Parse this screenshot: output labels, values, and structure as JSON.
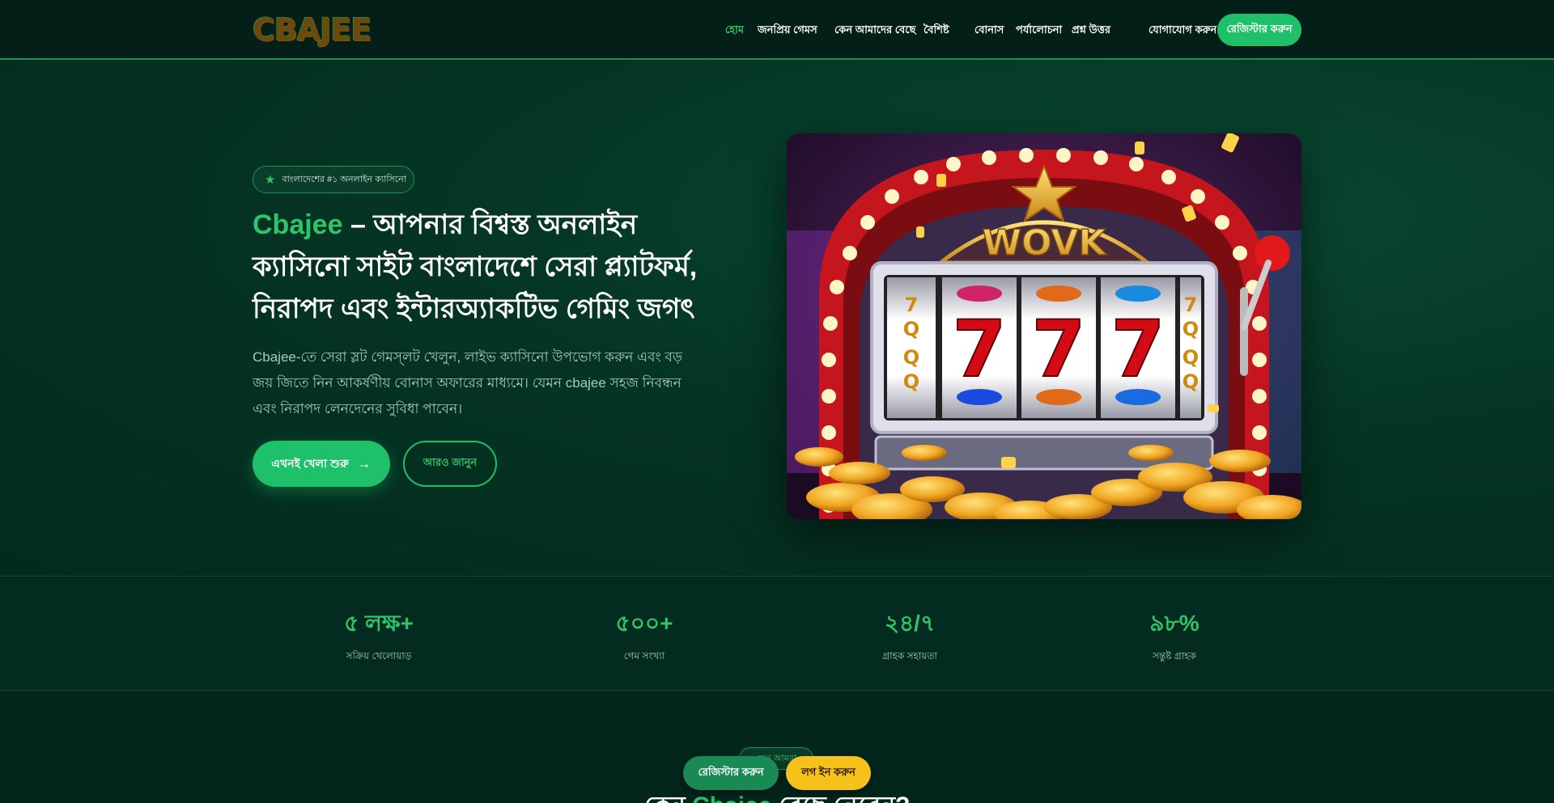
{
  "header": {
    "logo": "CBAJEE",
    "nav": [
      {
        "label": "হোম",
        "active": true
      },
      {
        "label": "জনপ্রিয় গেমস"
      },
      {
        "label": "কেন আমাদের বেছে"
      },
      {
        "label": "বৈশিষ্ট"
      },
      {
        "label": "বোনাস"
      },
      {
        "label": "পর্যালোচনা"
      },
      {
        "label": "প্রশ্ন উত্তর"
      },
      {
        "label": "যোগাযোগ করুন"
      }
    ],
    "cta": "রেজিস্টার করুন"
  },
  "hero": {
    "badge": "বাংলাদেশের #১ অনলাইন ক্যাসিনো",
    "title_brand": "Cbajee",
    "title_rest": " – আপনার বিশ্বস্ত অনলাইন ক্যাসিনো সাইট বাংলাদেশে সেরা প্ল্যাটফর্ম, নিরাপদ এবং ইন্টারঅ্যাকটিভ গেমিং জগৎ",
    "description": "Cbajee-তে সেরা স্লট গেমস্‌লট খেলুন, লাইভ ক্যাসিনো উপভোগ করুন এবং বড় জয় জিতে নিন আকর্ষণীয় বোনাস অফারের মাধ্যমে। যেমন cbajee সহজ নিবন্ধন এবং নিরাপদ লেনদেনের সুবিধা পাবেন।",
    "primary_button": "এখনই খেলা শুরু",
    "secondary_button": "আরও জানুন",
    "icons": {
      "badge": "star-icon",
      "primary": "arrow-right-icon"
    }
  },
  "stats": [
    {
      "value": "৫ লক্ষ+",
      "label": "সক্রিয় খেলোয়াড়"
    },
    {
      "value": "৫০০+",
      "label": "গেম সংখ্যা"
    },
    {
      "value": "২৪/৭",
      "label": "গ্রাহক সহায়তা"
    },
    {
      "value": "৯৮%",
      "label": "সন্তুষ্ট গ্রাহক"
    }
  ],
  "section": {
    "tag": "কেন আমরা",
    "title_pre": "কেন ",
    "title_brand": "Cbajee",
    "title_post": " বেছে নেবেন?"
  },
  "floating": {
    "register": "রেজিস্টার করুন",
    "login": "লগ ইন করুন"
  },
  "slot_machine": {
    "sign": "WOVK",
    "reels": [
      "7",
      "7",
      "7"
    ]
  },
  "colors": {
    "accent": "#1fc06a",
    "accent_text": "#2fc46a",
    "background": "#03261c",
    "gold": "#f5c11a"
  }
}
